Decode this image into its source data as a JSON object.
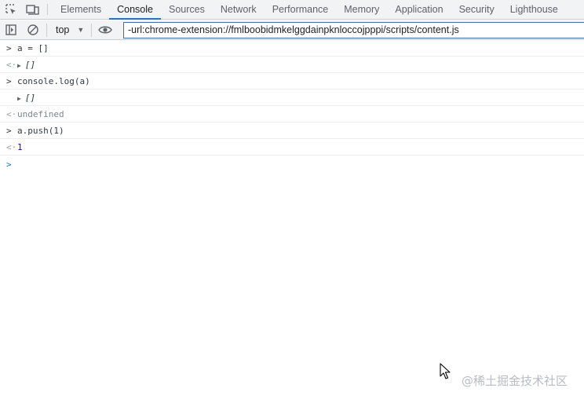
{
  "tabs": [
    {
      "label": "Elements",
      "active": false
    },
    {
      "label": "Console",
      "active": true
    },
    {
      "label": "Sources",
      "active": false
    },
    {
      "label": "Network",
      "active": false
    },
    {
      "label": "Performance",
      "active": false
    },
    {
      "label": "Memory",
      "active": false
    },
    {
      "label": "Application",
      "active": false
    },
    {
      "label": "Security",
      "active": false
    },
    {
      "label": "Lighthouse",
      "active": false
    }
  ],
  "toolbar": {
    "context": "top",
    "filter_value": "-url:chrome-extension://fmlboobidmkelggdainpknloccojpppi/scripts/content.js"
  },
  "console": {
    "entries": [
      {
        "kind": "input",
        "text": "a = []"
      },
      {
        "kind": "result",
        "text": "[]"
      },
      {
        "kind": "input",
        "text": "console.log(a)"
      },
      {
        "kind": "log",
        "text": "[]"
      },
      {
        "kind": "result",
        "text": "undefined"
      },
      {
        "kind": "input",
        "text": "a.push(1)"
      },
      {
        "kind": "result",
        "text": "1"
      }
    ]
  },
  "watermark": "@稀土掘金技术社区",
  "icons": {
    "inspect": "inspect-element-icon",
    "device": "device-toolbar-icon",
    "sidebar": "show-sidebar-icon",
    "clear": "clear-console-icon",
    "eye": "live-expression-icon"
  },
  "colors": {
    "accent": "#1a73e8",
    "toolbar_bg": "#f1f3f4",
    "number": "#1c00cf"
  }
}
